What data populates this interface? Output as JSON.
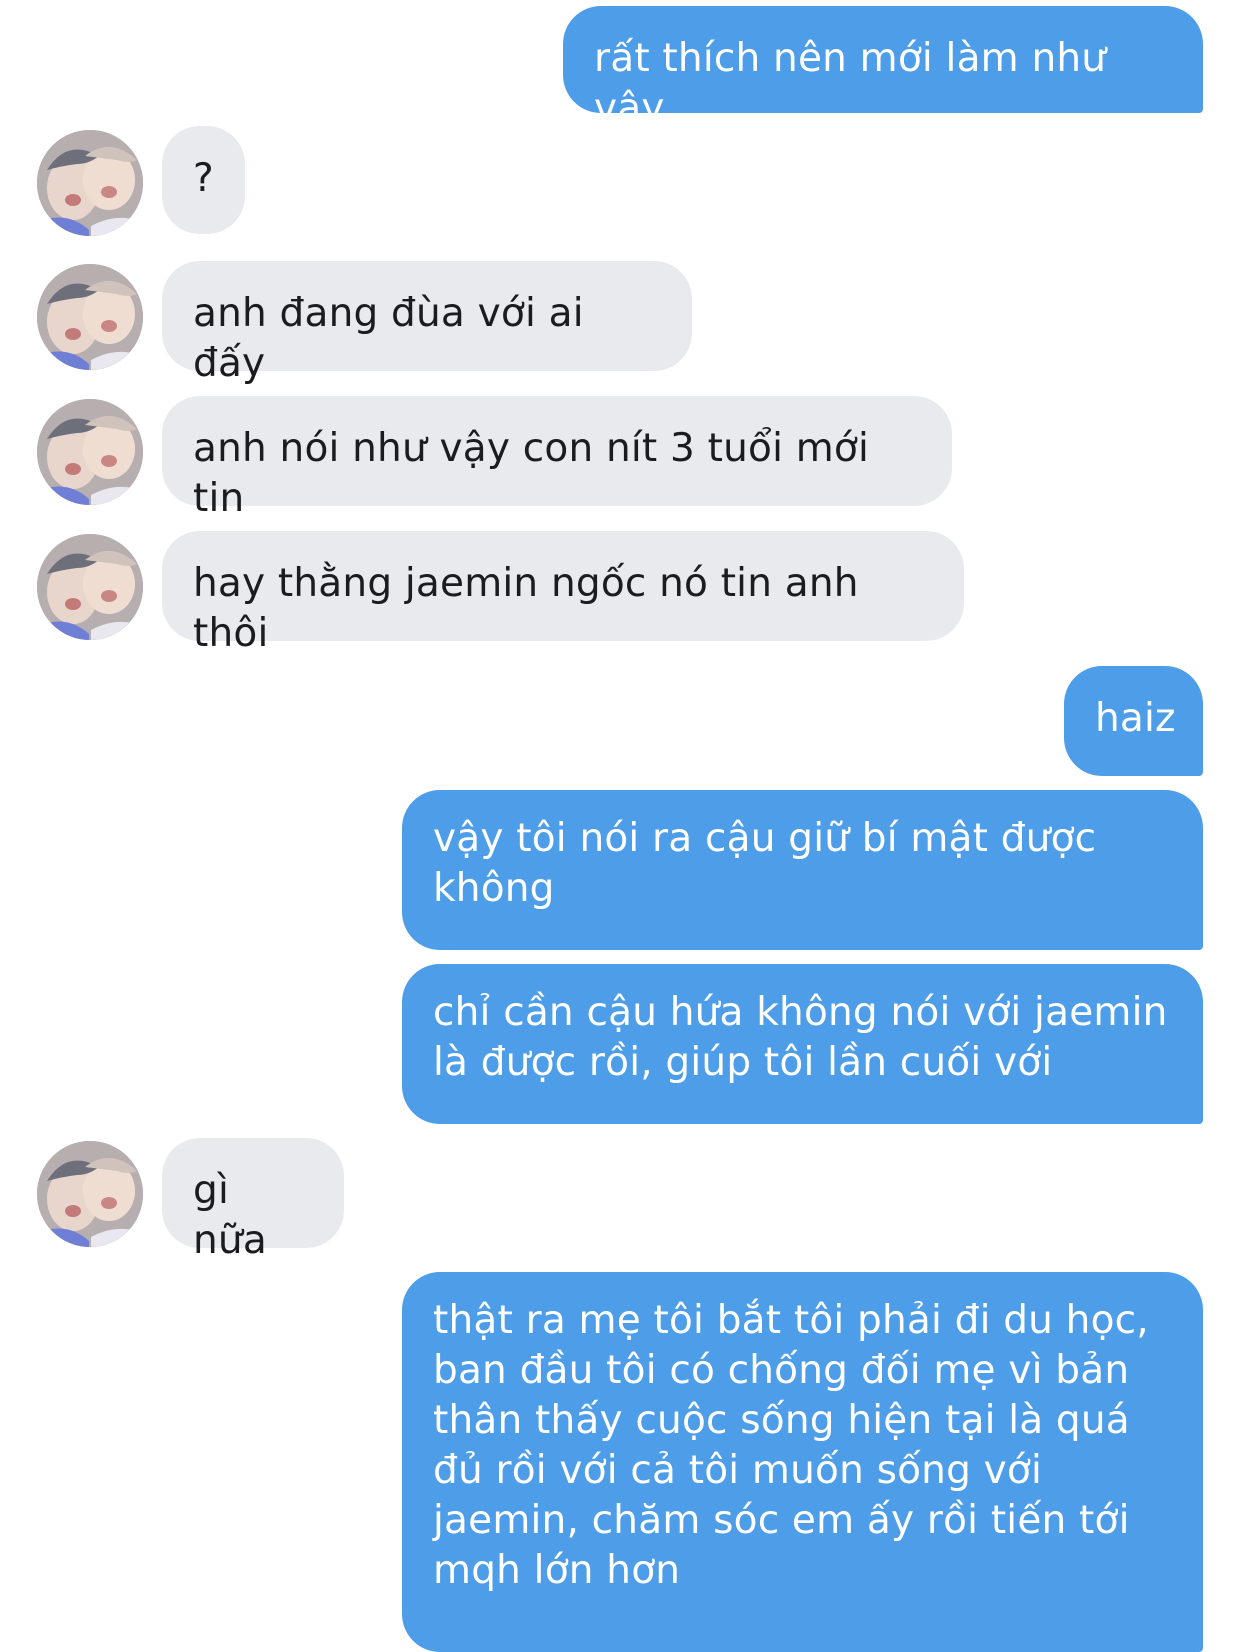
{
  "conversation": {
    "messages": [
      {
        "side": "out",
        "text": "rất thích nên mới làm như vậy"
      },
      {
        "side": "in",
        "text": "?"
      },
      {
        "side": "in",
        "text": "anh đang đùa với ai đấy"
      },
      {
        "side": "in",
        "text": "anh nói như vậy con nít 3 tuổi mới tin"
      },
      {
        "side": "in",
        "text": "hay thằng jaemin ngốc nó tin anh thôi"
      },
      {
        "side": "out",
        "text": "haiz"
      },
      {
        "side": "out",
        "text": "vậy tôi nói ra cậu giữ bí mật được không"
      },
      {
        "side": "out",
        "text": "chỉ cần cậu hứa không nói với jaemin là được rồi, giúp tôi lần cuối với"
      },
      {
        "side": "in",
        "text": "gì nữa"
      },
      {
        "side": "out",
        "text": "thật ra mẹ tôi bắt tôi phải đi du học, ban đầu tôi có chống đối mẹ vì bản thân thấy cuộc sống hiện tại là quá đủ rồi với cả tôi muốn sống với jaemin, chăm sóc em ấy rồi tiến tới mqh lớn hơn"
      }
    ]
  },
  "colors": {
    "outgoing_bubble": "#4d9de8",
    "incoming_bubble": "#e9eaee",
    "incoming_text": "#1c1c1e",
    "outgoing_text": "#ffffff"
  },
  "icons": {
    "avatar": "contact-avatar-photo"
  }
}
